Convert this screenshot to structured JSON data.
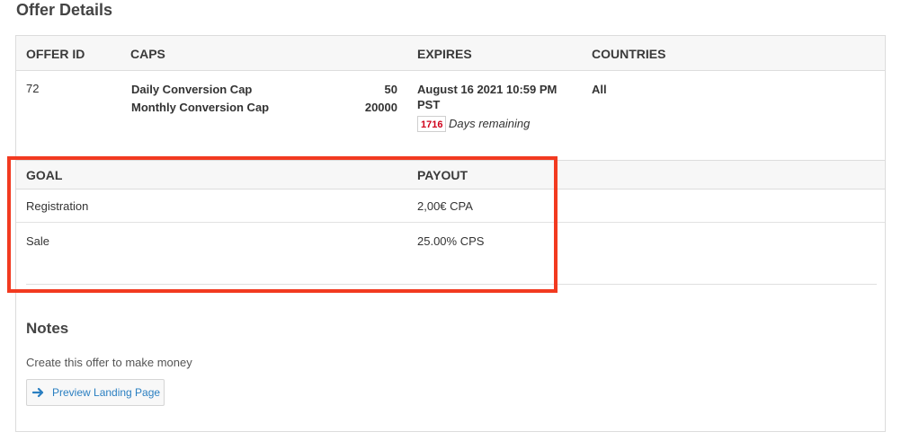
{
  "page": {
    "title": "Offer Details"
  },
  "offer_table": {
    "headers": {
      "offer_id": "OFFER ID",
      "caps": "CAPS",
      "expires": "EXPIRES",
      "countries": "COUNTRIES"
    },
    "row": {
      "offer_id": "72",
      "caps": [
        {
          "label": "Daily Conversion Cap",
          "value": "50"
        },
        {
          "label": "Monthly Conversion Cap",
          "value": "20000"
        }
      ],
      "expires_line1": "August 16 2021 10:59 PM",
      "expires_line2": "PST",
      "days_remaining_count": "1716",
      "days_remaining_label": "Days remaining",
      "countries": "All"
    }
  },
  "payout_table": {
    "headers": {
      "goal": "GOAL",
      "payout": "PAYOUT"
    },
    "rows": [
      {
        "goal": "Registration",
        "payout": "2,00€ CPA"
      },
      {
        "goal": "Sale",
        "payout": "25.00% CPS"
      }
    ]
  },
  "notes": {
    "title": "Notes",
    "text": "Create this offer to make money",
    "preview_button_label": "Preview Landing Page"
  },
  "colors": {
    "highlight": "#f23a20",
    "badge_text": "#d0021b",
    "link": "#2a7fc1"
  }
}
